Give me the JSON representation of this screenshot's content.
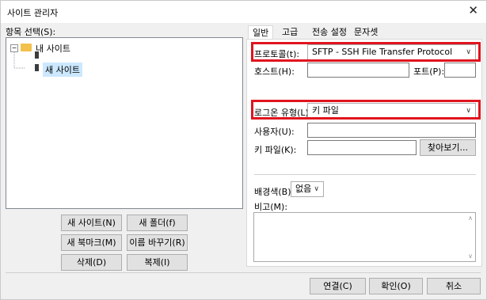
{
  "window": {
    "title": "사이트 관리자"
  },
  "tree": {
    "label": "항목 선택(S):",
    "root": "내 사이트",
    "child": "새 사이트"
  },
  "left_buttons": {
    "new_site": "새 사이트(N)",
    "new_folder": "새 폴더(f)",
    "new_bookmark": "새 북마크(M)",
    "rename": "이름 바꾸기(R)",
    "delete": "삭제(D)",
    "copy": "복제(I)"
  },
  "tabs": [
    "일반",
    "고급",
    "전송 설정",
    "문자셋"
  ],
  "general": {
    "protocol_label": "프로토콜(t):",
    "protocol_value": "SFTP - SSH File Transfer Protocol",
    "host_label": "호스트(H):",
    "host_value": "",
    "port_label": "포트(P):",
    "port_value": "",
    "logon_type_label": "로그온 유형(L):",
    "logon_type_value": "키 파일",
    "user_label": "사용자(U):",
    "user_value": "",
    "keyfile_label": "키 파일(K):",
    "keyfile_value": "",
    "browse_button": "찾아보기...",
    "bgcolor_label": "배경색(B):",
    "bgcolor_value": "없음",
    "comments_label": "비고(M):",
    "comments_value": ""
  },
  "bottom_buttons": {
    "connect": "연결(C)",
    "ok": "확인(O)",
    "cancel": "취소"
  },
  "colors": {
    "highlight": "#e0141e"
  }
}
